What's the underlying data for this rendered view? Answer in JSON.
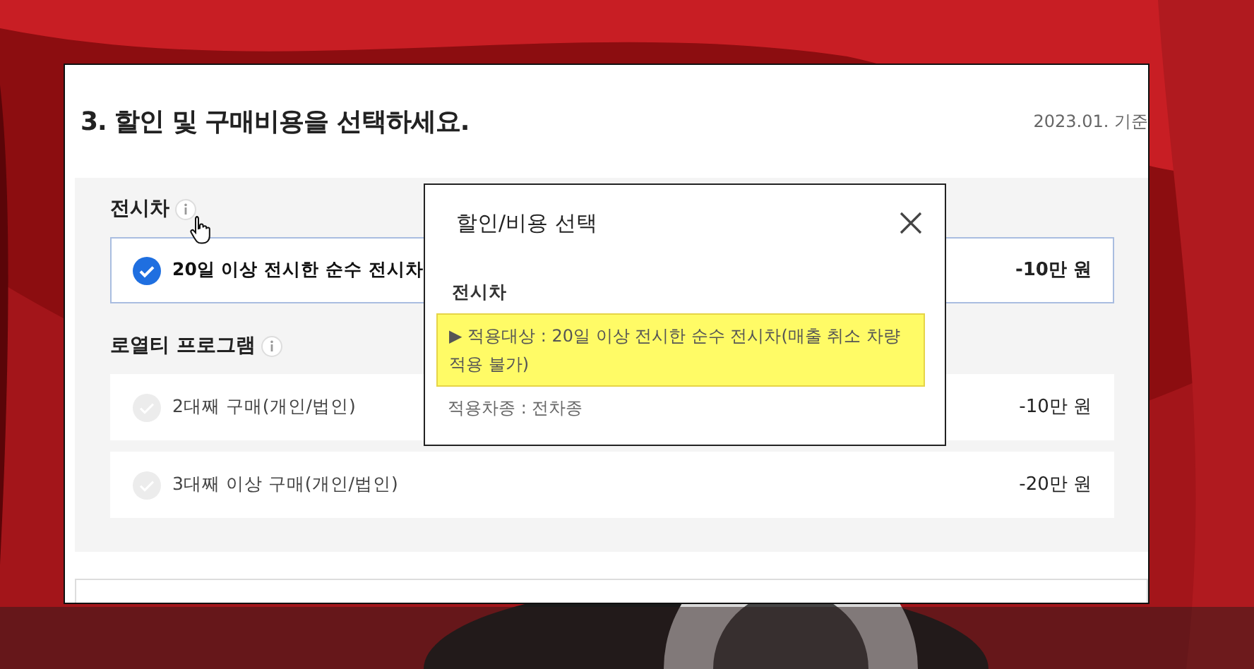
{
  "section": {
    "title": "3. 할인 및 구매비용을 선택하세요.",
    "date": "2023.01. 기준",
    "groups": [
      {
        "label": "전시차",
        "options": [
          {
            "label": "20일 이상 전시한 순수 전시차",
            "amount": "-10만 원",
            "selected": true
          }
        ]
      },
      {
        "label": "로열티 프로그램",
        "options": [
          {
            "label": "2대째 구매(개인/법인)",
            "amount": "-10만 원",
            "selected": false
          },
          {
            "label": "3대째 이상 구매(개인/법인)",
            "amount": "-20만 원",
            "selected": false
          }
        ]
      }
    ]
  },
  "popup": {
    "title": "할인/비용 선택",
    "subtitle": "전시차",
    "highlight": "▶ 적용대상 : 20일 이상 전시한 순수 전시차(매출 취소 차량 적용 불가)",
    "note": "적용차종 : 전차종"
  }
}
